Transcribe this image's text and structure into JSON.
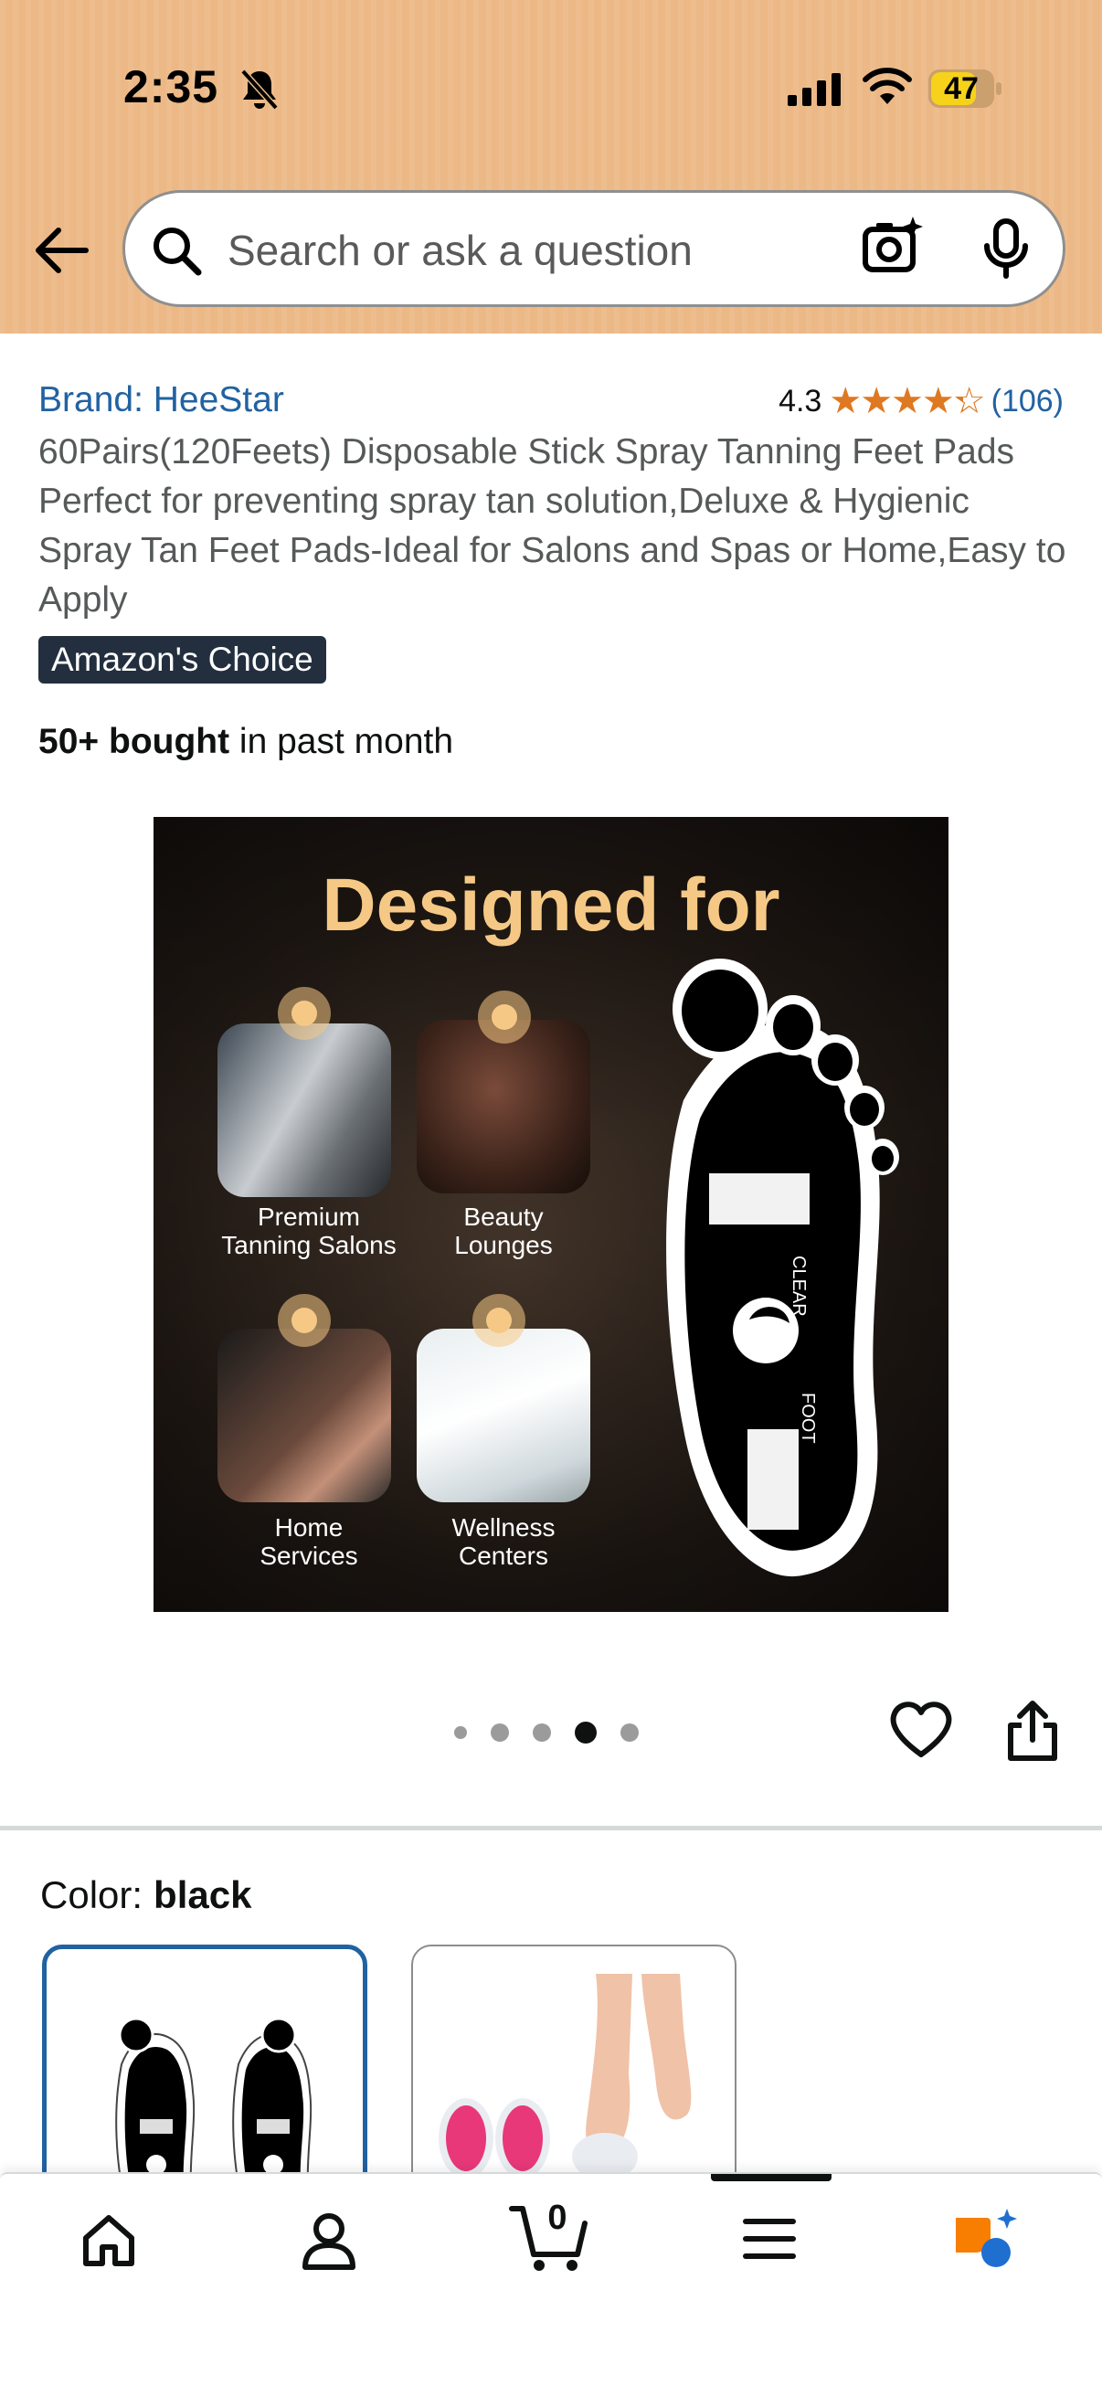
{
  "status_bar": {
    "time": "2:35",
    "battery": "47",
    "icons": [
      "bell-slash-icon",
      "cellular-signal-icon",
      "wifi-icon",
      "battery-icon"
    ]
  },
  "header": {
    "search_placeholder": "Search or ask a question",
    "icons": [
      "back-arrow-icon",
      "search-icon",
      "camera-lens-icon",
      "microphone-icon"
    ]
  },
  "product": {
    "brand": "Brand: HeeStar",
    "rating": "4.3",
    "rating_value": 4.3,
    "review_count": "(106)",
    "title": "60Pairs(120Feets) Disposable Stick Spray Tanning Feet Pads Perfect for preventing spray tan solution,Deluxe & Hygienic Spray Tan Feet Pads-Ideal for Salons and Spas or Home,Easy to Apply",
    "badge": "Amazon's Choice",
    "bought_bold": "50+ bought",
    "bought_rest": " in past month"
  },
  "hero_image": {
    "headline": "Designed for",
    "tiles": [
      {
        "line1": "Premium",
        "line2": "Tanning Salons"
      },
      {
        "line1": "Beauty",
        "line2": "Lounges"
      },
      {
        "line1": "Home",
        "line2": "Services"
      },
      {
        "line1": "Wellness",
        "line2": "Centers"
      }
    ],
    "pad_logo_top": "CLEAR",
    "pad_logo_bottom": "FOOT",
    "pager_total": 5,
    "pager_active": 4
  },
  "actions": {
    "icons": [
      "heart-icon",
      "share-icon"
    ]
  },
  "color_selector": {
    "label": "Color:",
    "selected": "black"
  },
  "bottom_nav": {
    "cart_count": "0",
    "icons": [
      "home-icon",
      "account-icon",
      "cart-icon",
      "menu-icon",
      "rufus-ai-icon"
    ],
    "accent": "#2162a1"
  }
}
